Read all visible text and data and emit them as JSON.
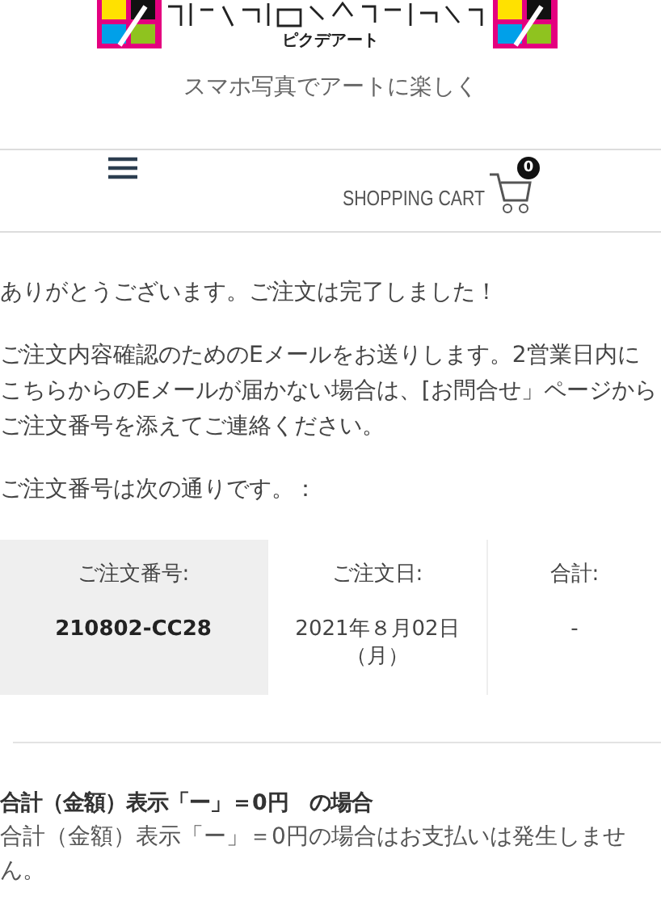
{
  "header": {
    "logo_sub": "ピクデアート",
    "tagline": "スマホ写真でアートに楽しく"
  },
  "nav": {
    "cart_label": "SHOPPING CART",
    "cart_count": "0"
  },
  "messages": [
    "ありがとうございます。ご注文は完了しました！",
    "ご注文内容確認のためのEメールをお送りします。2営業日内にこちらからのEメールが届かない場合は、[お問合せ」ページからご注文番号を添えてご連絡ください。",
    "ご注文番号は次の通りです。："
  ],
  "order_table": [
    {
      "label": "ご注文番号:",
      "value": "210802-CC28",
      "highlighted": true,
      "bold": true
    },
    {
      "label": "ご注文日:",
      "value": "2021年８月02日（月）",
      "highlighted": false,
      "bold": false
    },
    {
      "label": "合計:",
      "value": "-",
      "highlighted": false,
      "bold": false
    }
  ],
  "notice": {
    "title": "合計（金額）表示「ー」＝0円　の場合",
    "body": "合計（金額）表示「ー」＝0円の場合はお支払いは発生しません。"
  }
}
